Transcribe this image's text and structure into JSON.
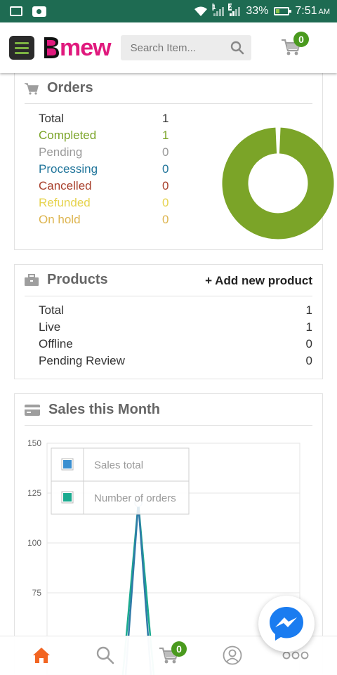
{
  "status_bar": {
    "sim1_label": "1",
    "sim2_label": "2",
    "battery": "33%",
    "battery_level": 0.33,
    "time": "7:51",
    "ampm": "AM"
  },
  "header": {
    "logo_text": "mew",
    "search_placeholder": "Search Item...",
    "cart_count": "0"
  },
  "orders": {
    "title": "Orders",
    "rows": [
      {
        "label": "Total",
        "value": "1",
        "color": "#333333"
      },
      {
        "label": "Completed",
        "value": "1",
        "color": "#7ba428"
      },
      {
        "label": "Pending",
        "value": "0",
        "color": "#9a9a9a"
      },
      {
        "label": "Processing",
        "value": "0",
        "color": "#21759b"
      },
      {
        "label": "Cancelled",
        "value": "0",
        "color": "#a8402c"
      },
      {
        "label": "Refunded",
        "value": "0",
        "color": "#e6d34e"
      },
      {
        "label": "On hold",
        "value": "0",
        "color": "#ddb44e"
      }
    ],
    "donut": [
      {
        "name": "Completed",
        "value": 1,
        "color": "#7ba428"
      }
    ]
  },
  "products": {
    "title": "Products",
    "add_label": "+ Add new product",
    "rows": [
      {
        "label": "Total",
        "value": "1"
      },
      {
        "label": "Live",
        "value": "1"
      },
      {
        "label": "Offline",
        "value": "0"
      },
      {
        "label": "Pending Review",
        "value": "0"
      }
    ]
  },
  "sales": {
    "title": "Sales this Month"
  },
  "chart_data": {
    "type": "line",
    "title": "Sales this Month",
    "yticks": [
      150,
      125,
      100,
      75
    ],
    "ylim": [
      60,
      150
    ],
    "grid": true,
    "legend_position": "top-left",
    "series": [
      {
        "name": "Sales total",
        "color": "#3b8fd0"
      },
      {
        "name": "Number of orders",
        "color": "#1aaa8f"
      }
    ],
    "visible_peak": 120
  },
  "bottom_nav": {
    "cart_count": "0",
    "items": [
      "home-icon",
      "search-icon",
      "cart-icon",
      "account-icon",
      "more-icon"
    ],
    "active_color": "#f26522"
  },
  "colors": {
    "status_bar": "#1e6b52",
    "brand_pink": "#e0197d",
    "badge_green": "#4a9a1e",
    "messenger_blue": "#1a7cf0"
  }
}
